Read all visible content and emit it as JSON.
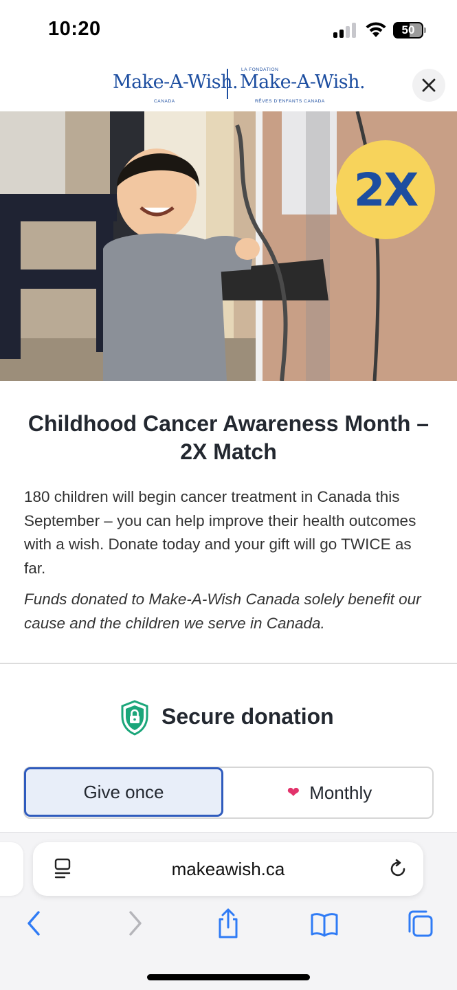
{
  "status_bar": {
    "time": "10:20",
    "battery": "50",
    "icons": [
      "signal-icon",
      "wifi-icon",
      "battery-icon"
    ]
  },
  "header": {
    "logo_left": {
      "name": "Make-A-Wish.",
      "sub": "CANADA"
    },
    "logo_right": {
      "top": "LA FONDATION",
      "name": "Make-A-Wish.",
      "sub": "RÊVES D'ENFANTS CANADA"
    },
    "close_icon": "close-icon"
  },
  "hero": {
    "badge": "2X",
    "accent_color": "#f7d35b",
    "badge_text_color": "#1d4ea0"
  },
  "content": {
    "title": "Childhood Cancer Awareness Month – 2X Match",
    "body": "180 children will begin cancer treatment in Canada this September – you can help improve their health outcomes with a wish. Donate today and your gift will go TWICE as far.",
    "note": "Funds donated to Make-A-Wish Canada solely benefit our cause and the children we serve in Canada."
  },
  "donation": {
    "secure_label": "Secure donation",
    "frequency_options": [
      {
        "label": "Give once",
        "selected": true
      },
      {
        "label": "Monthly",
        "selected": false,
        "icon": "heart-icon"
      }
    ],
    "selected_color": "#2f5bbd"
  },
  "browser": {
    "url": "makeawish.ca",
    "toolbar_icons": [
      "back-icon",
      "forward-icon",
      "share-icon",
      "bookmarks-icon",
      "tabs-icon"
    ]
  }
}
